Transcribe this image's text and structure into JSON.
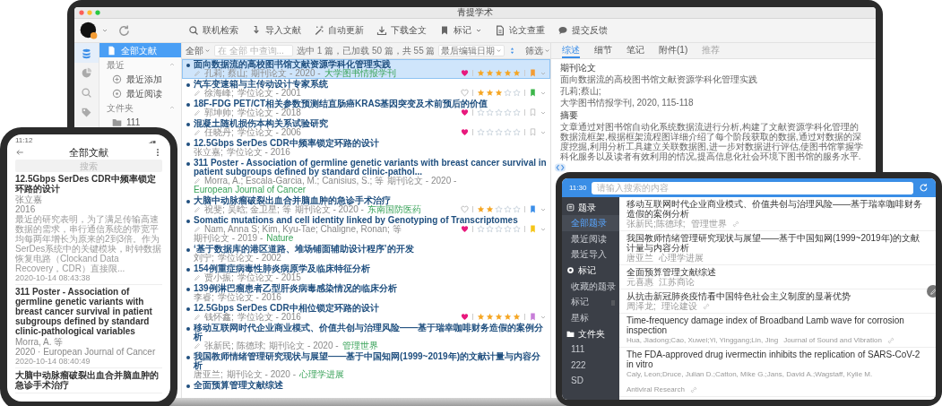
{
  "laptop": {
    "window": {
      "title": "青提学术"
    },
    "toolbar": [
      {
        "label": "联机检索",
        "dropdown": false
      },
      {
        "label": "导入文献",
        "dropdown": false
      },
      {
        "label": "自动更新",
        "dropdown": false
      },
      {
        "label": "下载全文",
        "dropdown": false
      },
      {
        "label": "标记",
        "dropdown": true
      },
      {
        "label": "论文查重",
        "dropdown": false
      },
      {
        "label": "提交反馈",
        "dropdown": false
      }
    ],
    "nav_rail": [
      {
        "selected": true
      },
      {
        "selected": false
      },
      {
        "selected": false
      },
      {
        "selected": false
      }
    ],
    "folders": [
      {
        "kind": "item",
        "label": "全部文献",
        "selected": true
      },
      {
        "kind": "section",
        "label": "最近"
      },
      {
        "kind": "recent-added",
        "label": "最近添加",
        "selected": false
      },
      {
        "kind": "recent-read",
        "label": "最近阅读",
        "selected": false
      },
      {
        "kind": "section",
        "label": "文件夹"
      },
      {
        "kind": "folder",
        "label": "111",
        "selected": false
      }
    ],
    "list_header": {
      "scope": "全部",
      "search_placeholder": "在 全部 中查询...",
      "status": "选中 1 篇，已加载 50 篇，共 55 篇",
      "sort": "最后编辑日期",
      "filter": "筛选"
    },
    "rows": [
      {
        "title": "面向数据流的高校图书馆文献资源学科化管理实践",
        "edited": true,
        "authors": "孔莉; 蔡山;",
        "info": "期刊论文 - 2020 -",
        "journal": "大学图书情报学刊",
        "selected": true,
        "rating": {
          "favorite": true,
          "stars": 5,
          "color": "#f39c34"
        }
      },
      {
        "title": "汽车变速箱与主传动设计专家系统",
        "edited": true,
        "authors": "徐海峰;",
        "info": "学位论文 - 2001",
        "selected": false,
        "rating": {
          "favorite": false,
          "stars": 3,
          "color": "#3cb64a"
        }
      },
      {
        "title": "18F-FDG PET/CT相关参数预测结直肠癌KRAS基因突变及术前预后的价值",
        "edited": true,
        "authors": "郭坤帅;",
        "info": "学位论文 - 2018",
        "selected": false,
        "rating": {
          "favorite": true,
          "stars": 0
        }
      },
      {
        "title": "混凝土随机损伤本构关系试验研究",
        "edited": true,
        "authors": "任晓丹;",
        "info": "学位论文 - 2006",
        "selected": false,
        "rating": {
          "favorite": true,
          "stars": 0
        }
      },
      {
        "title": "12.5Gbps SerDes CDR中频率锁定环路的设计",
        "edited": false,
        "authors": "张立嘉;",
        "info": "学位论文 - 2016",
        "selected": false
      },
      {
        "title": "311 Poster - Association of germline genetic variants with breast cancer survival in patient subgroups defined by standard clinic-pathol...",
        "edited": true,
        "authors": "Morra, A.; Escala-Garcia, M.; Canisius, S.; 等",
        "info": "期刊论文 - 2020 -",
        "journal": "European Journal of Cancer",
        "selected": false
      },
      {
        "title": "大脑中动脉瘤破裂出血合并脑血肿的急诊手术治疗",
        "edited": true,
        "authors": "祝斐; 吴晗; 金卫星; 等",
        "info": "期刊论文 - 2020 -",
        "journal": "东南国防医药",
        "selected": false,
        "rating": {
          "favorite": false,
          "stars": 2,
          "color": "#3b8ee8"
        }
      },
      {
        "title": "Somatic mutations and cell identity linked by Genotyping of Transcriptomes",
        "edited": true,
        "authors": "Nam, Anna S; Kim, Kyu-Tae; Chaligne, Ronan; 等",
        "info": "期刊论文 - 2019 -",
        "journal": "Nature",
        "selected": false,
        "rating": {
          "favorite": true,
          "stars": 0,
          "color": "#f5c518"
        }
      },
      {
        "title": "‘基于数据库的港区道路、堆场铺面辅助设计程序’的开发",
        "edited": false,
        "authors": "刘宁;",
        "info": "学位论文 - 2002",
        "selected": false
      },
      {
        "title": "154例重症病毒性肺炎病原学及临床特征分析",
        "edited": true,
        "authors": "贾小振;",
        "info": "学位论文 - 2015",
        "selected": false
      },
      {
        "title": "139例淋巴瘤患者乙型肝炎病毒感染情况的临床分析",
        "edited": false,
        "authors": "李睿;",
        "info": "学位论文 - 2016",
        "selected": false
      },
      {
        "title": "12.5Gbps SerDes CDR中相位锁定环路的设计",
        "edited": true,
        "authors": "钱怀鑫;",
        "info": "学位论文 - 2016",
        "selected": false,
        "rating": {
          "favorite": true,
          "stars": 5,
          "color": "#c77dd8"
        }
      },
      {
        "title": "移动互联网时代企业商业模式、价值共创与治理风险——基于瑞幸咖啡财务造假的案例分析",
        "edited": true,
        "authors": "张新民; 陈德球;",
        "info": "期刊论文 - 2020 -",
        "journal": "管理世界",
        "selected": false
      },
      {
        "title": "我国教师情绪管理研究现状与展望——基于中国知网(1999~2019年)的文献计量与内容分析",
        "edited": false,
        "authors": "唐亚兰;",
        "info": "期刊论文 - 2020 -",
        "journal": "心理学进展",
        "selected": false
      },
      {
        "title": "全面预算管理文献综述",
        "selected": false
      }
    ],
    "detail": {
      "tabs": [
        {
          "label": "综述",
          "selected": true,
          "disabled": false
        },
        {
          "label": "细节",
          "selected": false,
          "disabled": false
        },
        {
          "label": "笔记",
          "selected": false,
          "disabled": false
        },
        {
          "label": "附件(1)",
          "selected": false,
          "disabled": false
        },
        {
          "label": "推荐",
          "selected": false,
          "disabled": true
        }
      ],
      "type": "期刊论文",
      "title": "面向数据流的高校图书馆文献资源学科化管理实践",
      "authors": "孔莉;蔡山;",
      "source": "大学图书情报学刊, 2020, 115-118",
      "abstract_heading": "摘要",
      "abstract": "文章通过对图书馆自动化系统数据流进行分析,构建了文献资源学科化管理的数据流框架,根据框架流程图详细介绍了每个阶段获取的数据,通过对数据的深度挖掘,利用分析工具建立关联数据图,进一步对数据进行评估,使图书馆掌握学科化服务以及读者有效利用的情况,提高信息化社会环境下图书馆的服务水平."
    }
  },
  "phone": {
    "status_time": "11:12",
    "title": "全部文献",
    "search_placeholder": "搜索",
    "items": [
      {
        "title": "12.5Gbps SerDes CDR中频率锁定环路的设计",
        "authors": "张立嘉",
        "source": "2016",
        "abstract": "最近的研究表明，为了满足传输高速数据的需求，串行通信系统的带宽平均每两年增长为原来的2到3倍。作为SerDes系统中的关键模块，时钟数据恢复电路（Clockand Data Recovery，CDR）直接限...",
        "saved_at": "2020-10-14 08:43:38"
      },
      {
        "title": "311 Poster - Association of germline genetic variants with breast cancer survival in patient subgroups defined by standard clinic-pathological variables",
        "authors": "Morra, A. 等",
        "source": "2020 · European Journal of Cancer",
        "saved_at": "2020-10-14 08:40:49"
      },
      {
        "title": "大脑中动脉瘤破裂出血合并脑血肿的急诊手术治疗"
      }
    ]
  },
  "tablet": {
    "status_time": "11:30",
    "search_placeholder": "请输入搜索的内容",
    "sidebar": [
      {
        "label": "题录",
        "items": [
          {
            "label": "全部题录",
            "selected": true
          },
          {
            "label": "最近阅读",
            "selected": false
          },
          {
            "label": "最近导入",
            "selected": false
          }
        ]
      },
      {
        "label": "标记",
        "items": [
          {
            "label": "收藏的题录",
            "selected": false
          },
          {
            "label": "标记",
            "selected": false
          },
          {
            "label": "星标",
            "selected": false
          }
        ]
      },
      {
        "label": "文件夹",
        "items": [
          {
            "label": "111",
            "selected": false
          },
          {
            "label": "222",
            "selected": false
          },
          {
            "label": "SD",
            "selected": false
          }
        ]
      }
    ],
    "items": [
      {
        "title": "移动互联网时代企业商业模式、价值共创与治理风险——基于瑞幸咖啡财务造假的案例分析",
        "authors": "张新民;陈德球;",
        "source": "管理世界",
        "linked": true
      },
      {
        "title": "我国教师情绪管理研究现状与展望——基于中国知网(1999~2019年)的文献计量与内容分析",
        "authors": "唐亚兰",
        "source": "心理学进展",
        "linked": false
      },
      {
        "title": "全面预算管理文献综述",
        "authors": "元喜惠",
        "source": "江苏商论",
        "linked": false
      },
      {
        "title": "从抗击新冠肺炎疫情看中国特色社会主义制度的显著优势",
        "authors": "周泽龙;",
        "source": "理论建设",
        "linked": true
      },
      {
        "title": "Time-frequency damage index of Broadband Lamb wave for corrosion inspection",
        "authors": "Hua, Jiadong;Cao, Xuwei;Yi, Yinggang;Lin, Jing",
        "source": "Journal of Sound and Vibration",
        "linked": true
      },
      {
        "title": "The FDA-approved drug ivermectin inhibits the replication of SARS-CoV-2 in vitro",
        "authors": "Caly, Leon;Druce, Julian D.;Catton, Mike G.;Jans, David A.;Wagstaff, Kylie M.",
        "source": "Antiviral Research",
        "linked": true
      }
    ]
  }
}
